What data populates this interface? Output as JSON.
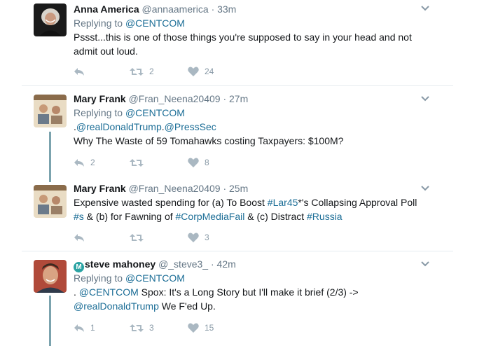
{
  "tweets": [
    {
      "name": "Anna America",
      "handle": "@annaamerica",
      "time": "· 33m",
      "reply_prefix": "Replying to",
      "reply_to": "@CENTCOM",
      "text_line1": "Pssst...this is one of those things you're supposed to say in your head and not",
      "text_line2": "admit out loud.",
      "retweets": "2",
      "likes": "24"
    },
    {
      "name": "Mary Frank",
      "handle": "@Fran_Neena20409",
      "time": "· 27m",
      "reply_prefix": "Replying to",
      "reply_to": "@CENTCOM",
      "mention_prefix": ".",
      "mention1": "@realDonaldTrump",
      "mention_sep": ".",
      "mention2": "@PressSec",
      "text_line2": "Why The Waste of 59 Tomahawks costing Taxpayers: $100M?",
      "replies": "2",
      "likes": "8"
    },
    {
      "name": "Mary Frank",
      "handle": "@Fran_Neena20409",
      "time": "· 25m",
      "line1_a": "Expensive wasted spending for (a) To Boost ",
      "line1_tag": "#Lar45",
      "line1_b": "*'s Collapsing Approval Poll",
      "line2_tag1": "#s",
      "line2_a": " & (b) for Fawning of ",
      "line2_tag2": "#CorpMediaFail",
      "line2_b": " & (c) Distract ",
      "line2_tag3": "#Russia",
      "likes": "3"
    },
    {
      "badge": "M",
      "name": "steve mahoney",
      "handle": "@_steve3_",
      "time": "· 42m",
      "reply_prefix": "Replying to",
      "reply_to": "@CENTCOM",
      "line1_a": ". ",
      "line1_mention": "@CENTCOM",
      "line1_b": " Spox:  It's a Long Story but I'll make it brief (2/3) ->",
      "line2_mention": "@realDonaldTrump",
      "line2_b": "  We F'ed Up.",
      "replies": "1",
      "retweets": "3",
      "likes": "15"
    }
  ],
  "icons": [
    "reply-icon",
    "retweet-icon",
    "like-icon",
    "chevron-down-icon"
  ],
  "colors": {
    "link": "#1b6d96",
    "thread": "#7ba3ae",
    "meta": "#657786",
    "icon": "#aab8c2"
  }
}
